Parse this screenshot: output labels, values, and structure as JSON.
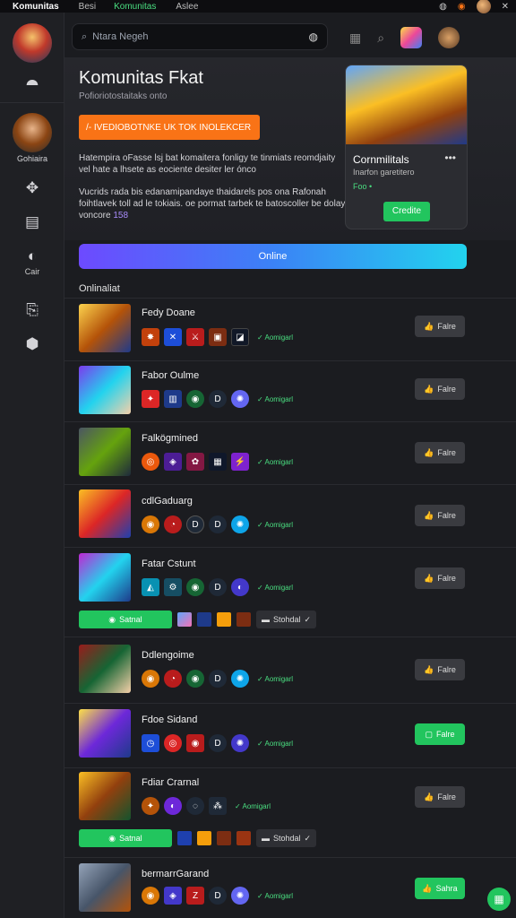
{
  "topbar": {
    "title": "Komunitas",
    "tab1": "Besi",
    "tab2": "Komunitas",
    "tab3": "Aslee",
    "close": "✕"
  },
  "rail": {
    "label1": "Gohiaira",
    "label2": "Cair"
  },
  "search": {
    "placeholder": "Ntara Negeh"
  },
  "hero": {
    "title": "Komunitas Fkat",
    "subtitle": "Pofioriotostaitaks onto",
    "cta": "/- IVEDIOBOTNKE UK TOK INOLEKCER",
    "para1": "Hatempira oFasse lsj bat komaitera fonligy te tinmiats reomdjaity vel hate a lhsete as eociente desiter ler ónco",
    "para2": "Vucrids rada bis edanamipandaye thaidarels pos ona Rafonah foihtlavek toll ad le tokiais. oe pormat tarbek te batoscoller be dolay voncore",
    "para2_highlight": "158"
  },
  "card": {
    "title": "Cornmilitals",
    "meta": "Inarfon garetitero",
    "tag": "Foo •",
    "button": "Credite",
    "dots": "•••"
  },
  "online_label": "Online",
  "section_title": "Onlinaliat",
  "rows": [
    {
      "name": "Fedy Doane",
      "status": "✓ Aomigarl",
      "action": "Falre",
      "action_green": false
    },
    {
      "name": "Fabor Oulme",
      "status": "✓ Aomigarl",
      "action": "Falre",
      "action_green": false
    },
    {
      "name": "Falkögmined",
      "status": "✓ Aomigarl",
      "action": "Falre",
      "action_green": false
    },
    {
      "name": "cdlGaduarg",
      "status": "✓ Aomigarl",
      "action": "Falre",
      "action_green": false
    },
    {
      "name": "Fatar Cstunt",
      "status": "✓ Aomigarl",
      "action": "Falre",
      "action_green": false,
      "sub_button": "Satnal",
      "sub_pill": "Stohdal"
    },
    {
      "name": "Ddlengoime",
      "status": "✓ Aomigarl",
      "action": "Falre",
      "action_green": false
    },
    {
      "name": "Fdoe Sidand",
      "status": "✓ Aomigarl",
      "action": "Falre",
      "action_green": true
    },
    {
      "name": "Fdiar Crarnal",
      "status": "✓ Aomigarl",
      "action": "Falre",
      "action_green": false,
      "sub_button": "Satnal",
      "sub_pill": "Stohdal"
    },
    {
      "name": "bermarrGarand",
      "status": "✓ Aomigarl",
      "action": "Sahra",
      "action_green": true
    }
  ]
}
